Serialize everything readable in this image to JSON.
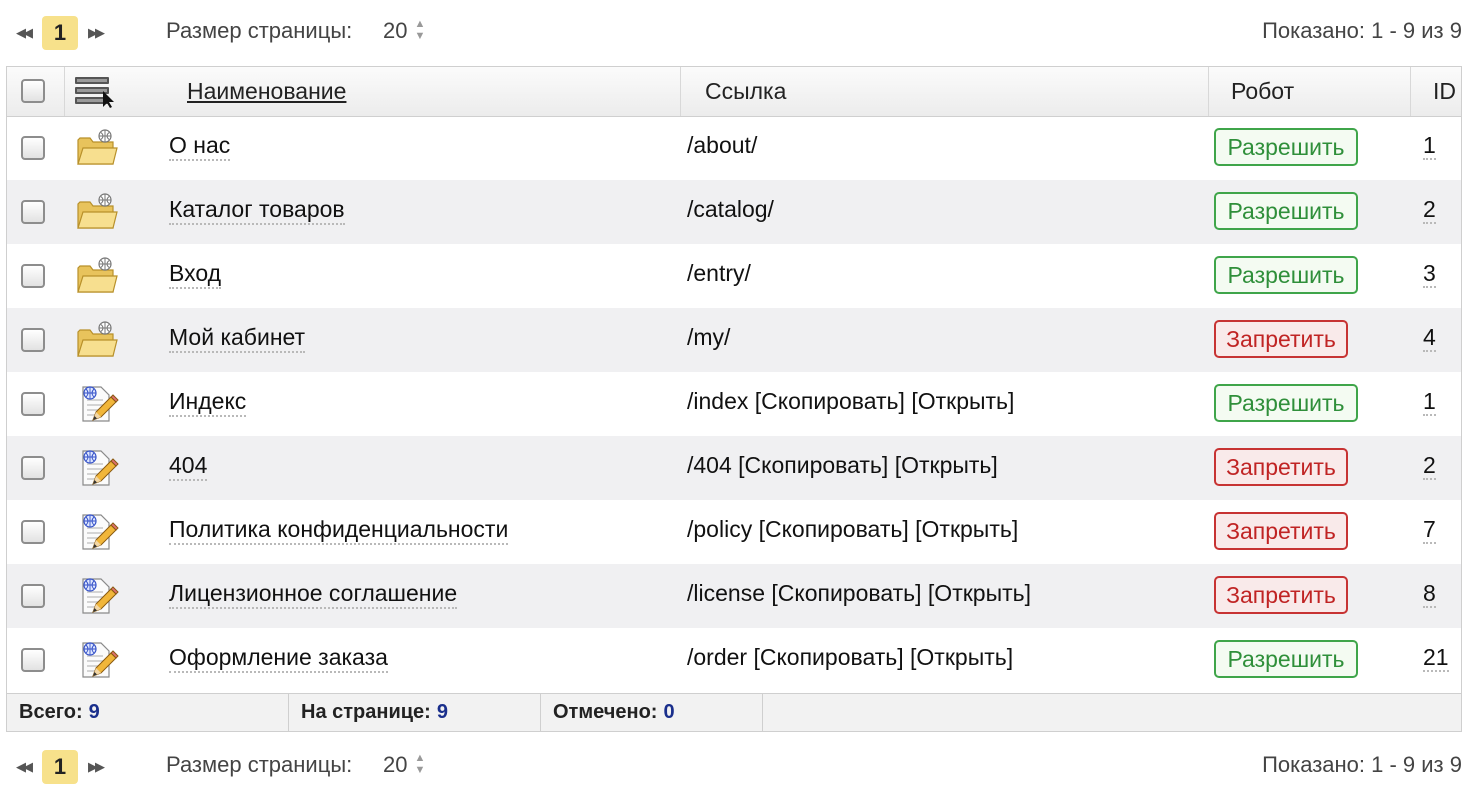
{
  "pager": {
    "current_page": "1",
    "size_label": "Размер страницы:",
    "size_value": "20",
    "shown_text": "Показано: 1 - 9 из 9"
  },
  "table": {
    "columns": {
      "name": "Наименование",
      "link": "Ссылка",
      "robot": "Робот",
      "id": "ID"
    },
    "rows": [
      {
        "type": "folder",
        "name": "О нас",
        "link": "/about/",
        "robot": "Разрешить",
        "robot_state": "allow",
        "id": "1"
      },
      {
        "type": "folder",
        "name": "Каталог товаров",
        "link": "/catalog/",
        "robot": "Разрешить",
        "robot_state": "allow",
        "id": "2"
      },
      {
        "type": "folder",
        "name": "Вход",
        "link": "/entry/",
        "robot": "Разрешить",
        "robot_state": "allow",
        "id": "3"
      },
      {
        "type": "folder",
        "name": "Мой кабинет",
        "link": "/my/",
        "robot": "Запретить",
        "robot_state": "deny",
        "id": "4"
      },
      {
        "type": "page",
        "name": "Индекс",
        "link": "/index",
        "copy": "[Скопировать]",
        "open": "[Открыть]",
        "robot": "Разрешить",
        "robot_state": "allow",
        "id": "1"
      },
      {
        "type": "page",
        "name": "404",
        "link": "/404",
        "copy": "[Скопировать]",
        "open": "[Открыть]",
        "robot": "Запретить",
        "robot_state": "deny",
        "id": "2"
      },
      {
        "type": "page",
        "name": "Политика конфиденциальности",
        "link": "/policy",
        "copy": "[Скопировать]",
        "open": "[Открыть]",
        "robot": "Запретить",
        "robot_state": "deny",
        "id": "7"
      },
      {
        "type": "page",
        "name": "Лицензионное соглашение",
        "link": "/license",
        "copy": "[Скопировать]",
        "open": "[Открыть]",
        "robot": "Запретить",
        "robot_state": "deny",
        "id": "8"
      },
      {
        "type": "page",
        "name": "Оформление заказа",
        "link": "/order",
        "copy": "[Скопировать]",
        "open": "[Открыть]",
        "robot": "Разрешить",
        "robot_state": "allow",
        "id": "21"
      }
    ]
  },
  "footer": {
    "total_label": "Всего:",
    "total_value": "9",
    "on_page_label": "На странице:",
    "on_page_value": "9",
    "selected_label": "Отмечено:",
    "selected_value": "0"
  },
  "colors": {
    "allow": "#3fa54a",
    "deny": "#c73333",
    "current_page_bg": "#f7e18b",
    "footer_value": "#1a2f8c"
  }
}
